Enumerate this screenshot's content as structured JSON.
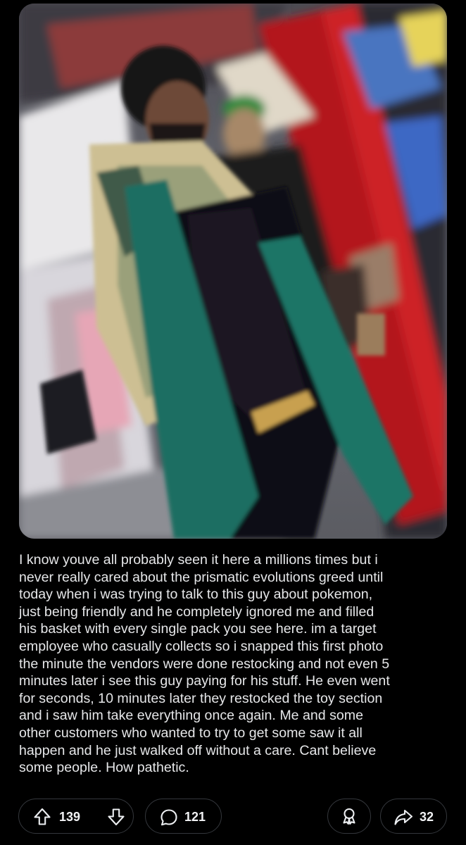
{
  "post": {
    "image_alt": "Photo of a shopper at a store checkout",
    "body": "I know youve all probably seen it here a millions times but i\nnever really cared about the prismatic evolutions greed until\ntoday when i was trying to talk to this guy about pokemon,\njust being friendly and he completely ignored me and filled\nhis basket with every single pack you see here. im a target\nemployee who casually collects so i snapped this first photo\nthe minute the vendors were done restocking and not even 5\nminutes later i see this guy paying for his stuff. He even went\nfor seconds, 10 minutes later they restocked the toy section\nand i saw him take everything once again. Me and some\nother customers who wanted to try to get some saw it all\nhappen and he just walked off without a care. Cant believe\nsome people. How pathetic."
  },
  "actions": {
    "upvotes": "139",
    "comments": "121",
    "shares": "32"
  },
  "icons": {
    "upvote": "upvote-arrow-icon",
    "downvote": "downvote-arrow-icon",
    "comment": "comment-bubble-icon",
    "award": "award-ribbon-icon",
    "share": "share-arrow-icon"
  },
  "colors": {
    "background": "#000000",
    "pill_border": "#34373c",
    "text": "#e6e7e9"
  }
}
